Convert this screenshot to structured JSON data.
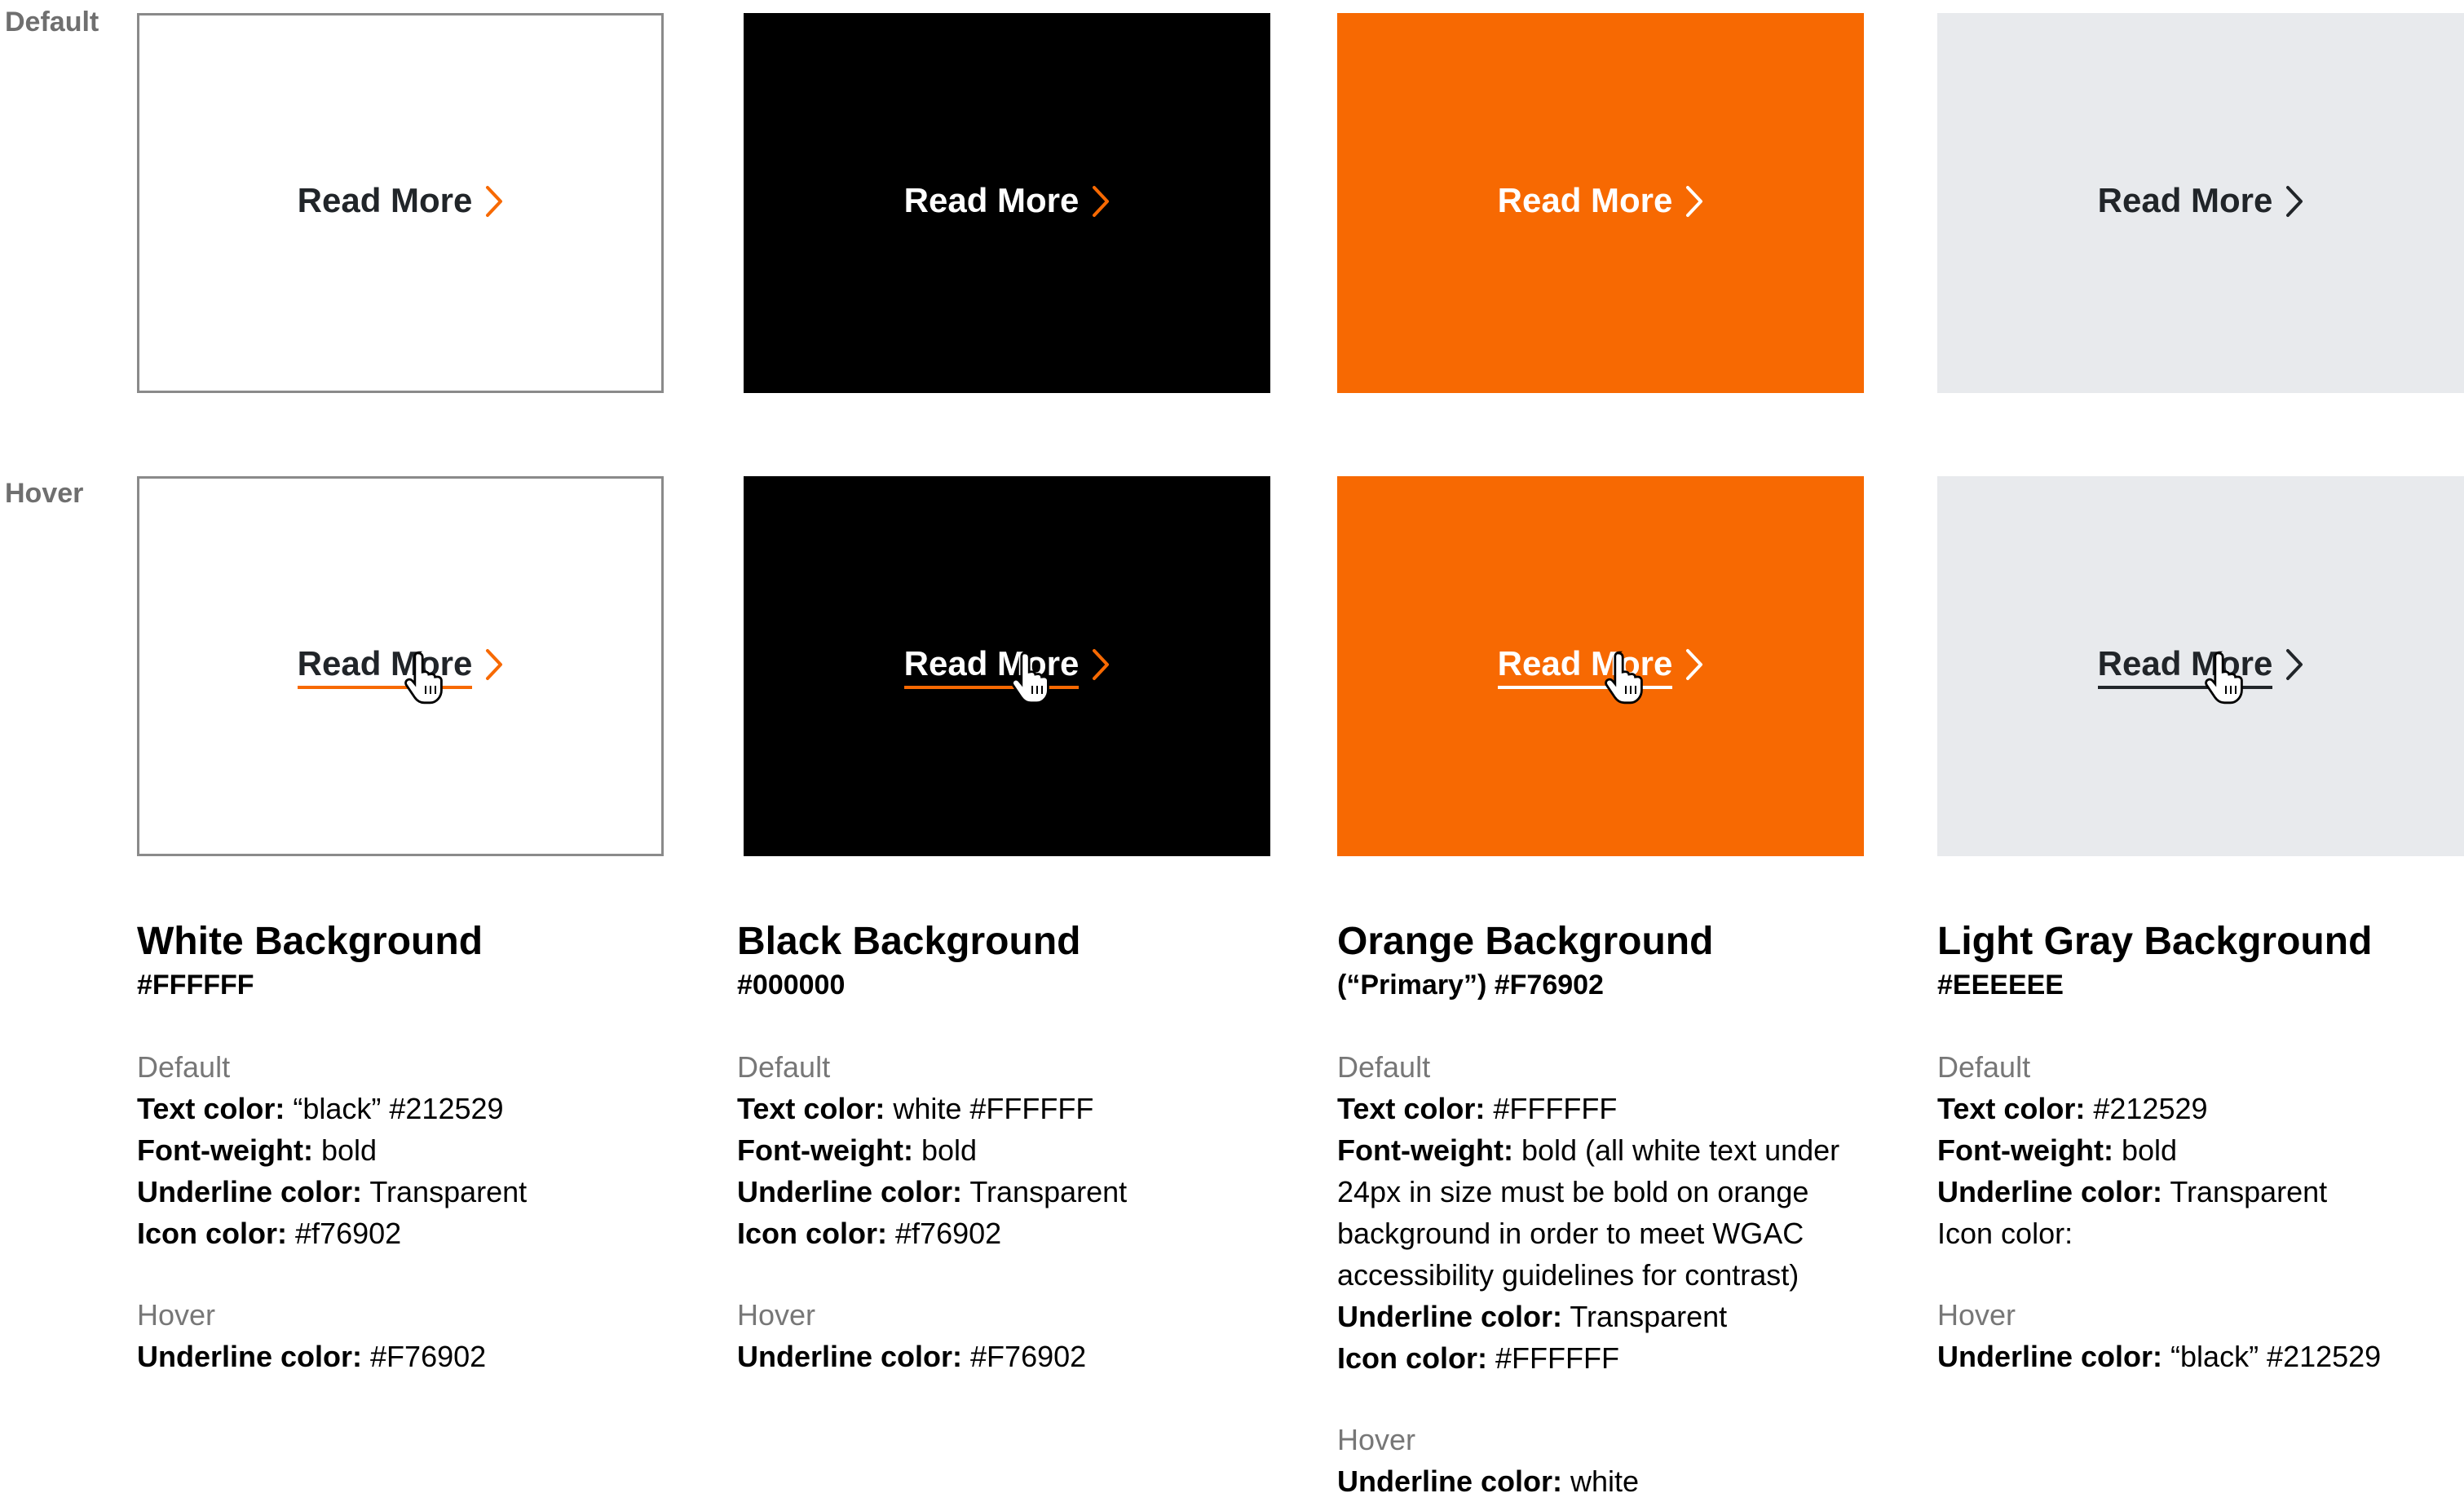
{
  "row_labels": {
    "default": "Default",
    "hover": "Hover"
  },
  "link_text": "Read More",
  "swatches": [
    {
      "bg": "#FFFFFF",
      "text_color": "#212529",
      "icon_color": "#F76902",
      "underline": "#F76902"
    },
    {
      "bg": "#000000",
      "text_color": "#FFFFFF",
      "icon_color": "#F76902",
      "underline": "#F76902"
    },
    {
      "bg": "#F76902",
      "text_color": "#FFFFFF",
      "icon_color": "#FFFFFF",
      "underline": "#FFFFFF"
    },
    {
      "bg": "#E8EAED",
      "text_color": "#212529",
      "icon_color": "#212529",
      "underline": "#212529"
    }
  ],
  "columns": [
    {
      "title": "White Background",
      "hex": "#FFFFFF",
      "default_title": "Default",
      "default_lines": [
        {
          "label": "Text color:",
          "value": " “black” #212529"
        },
        {
          "label": "Font-weight:",
          "value": " bold"
        },
        {
          "label": "Underline color:",
          "value": " Transparent"
        },
        {
          "label": "Icon color:",
          "value": " #f76902"
        }
      ],
      "hover_title": "Hover",
      "hover_lines": [
        {
          "label": "Underline color:",
          "value": " #F76902"
        }
      ]
    },
    {
      "title": "Black Background",
      "hex": "#000000",
      "default_title": "Default",
      "default_lines": [
        {
          "label": "Text color:",
          "value": " white #FFFFFF"
        },
        {
          "label": "Font-weight:",
          "value": " bold"
        },
        {
          "label": "Underline color:",
          "value": " Transparent"
        },
        {
          "label": "Icon color:",
          "value": " #f76902"
        }
      ],
      "hover_title": "Hover",
      "hover_lines": [
        {
          "label": "Underline color:",
          "value": " #F76902"
        }
      ]
    },
    {
      "title": "Orange Background",
      "hex": "(“Primary”) #F76902",
      "default_title": "Default",
      "default_lines": [
        {
          "label": "Text color:",
          "value": " #FFFFFF"
        },
        {
          "label": "Font-weight:",
          "value": " bold (all white text under 24px in size must be bold on orange background in order to meet WGAC accessibility guidelines for contrast)"
        },
        {
          "label": "Underline color:",
          "value": " Transparent"
        },
        {
          "label": "Icon color:",
          "value": " #FFFFFF"
        }
      ],
      "hover_title": "Hover",
      "hover_lines": [
        {
          "label": "Underline color:",
          "value": " white"
        }
      ]
    },
    {
      "title": "Light Gray Background",
      "hex": "#EEEEEE",
      "default_title": "Default",
      "default_lines": [
        {
          "label": "Text color:",
          "value": " #212529"
        },
        {
          "label": "Font-weight:",
          "value": " bold"
        },
        {
          "label": "Underline color:",
          "value": " Transparent"
        },
        {
          "label": "",
          "value": "Icon color:"
        }
      ],
      "hover_title": "Hover",
      "hover_lines": [
        {
          "label": "Underline color:",
          "value": " “black” #212529"
        }
      ]
    }
  ]
}
